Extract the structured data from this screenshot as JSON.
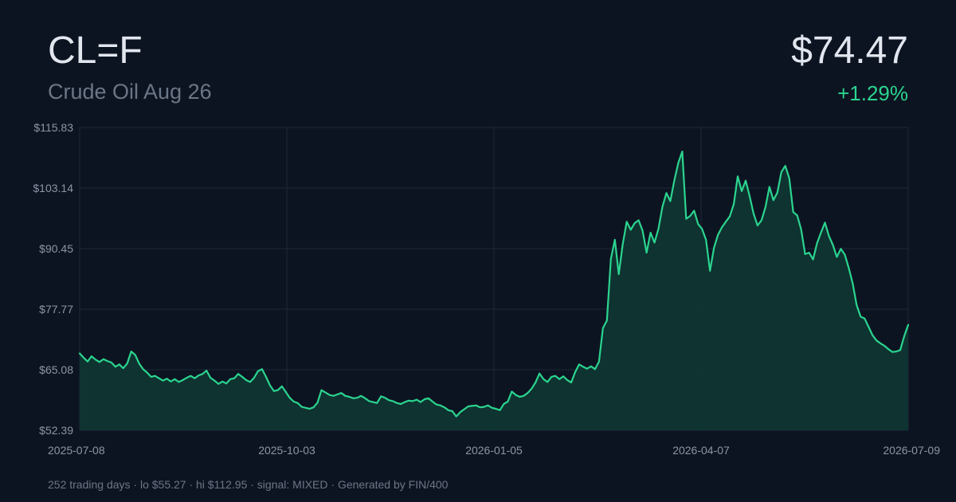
{
  "header": {
    "ticker": "CL=F",
    "name": "Crude Oil Aug 26",
    "price": "$74.47",
    "change": "+1.29%"
  },
  "footer": {
    "text": "252 trading days · lo $55.27 · hi $112.95 · signal: MIXED · Generated by FIN/400"
  },
  "colors": {
    "background": "#0d1421",
    "line": "#2bd48f",
    "fill": "#0f3532",
    "grid": "#1c2737",
    "positive": "#2bd48f"
  },
  "chart_data": {
    "type": "area",
    "ylim": [
      52.39,
      115.83
    ],
    "y_ticks": [
      "$115.83",
      "$103.14",
      "$90.45",
      "$77.77",
      "$65.08",
      "$52.39"
    ],
    "x_ticks": [
      "2025-07-08",
      "2025-10-03",
      "2026-01-05",
      "2026-04-07",
      "2026-07-09"
    ],
    "grid": true,
    "points": [
      [
        0,
        68.5
      ],
      [
        3,
        67.6
      ],
      [
        6,
        66.8
      ],
      [
        9,
        67.9
      ],
      [
        12,
        67.2
      ],
      [
        15,
        66.7
      ],
      [
        18,
        67.3
      ],
      [
        21,
        66.9
      ],
      [
        24,
        66.6
      ],
      [
        27,
        65.7
      ],
      [
        30,
        66.2
      ],
      [
        33,
        65.4
      ],
      [
        36,
        66.4
      ],
      [
        39,
        68.9
      ],
      [
        42,
        68.2
      ],
      [
        45,
        66.4
      ],
      [
        48,
        65.2
      ],
      [
        51,
        64.5
      ],
      [
        54,
        63.6
      ],
      [
        57,
        63.8
      ],
      [
        60,
        63.3
      ],
      [
        63,
        62.8
      ],
      [
        66,
        63.2
      ],
      [
        69,
        62.6
      ],
      [
        72,
        63.1
      ],
      [
        75,
        62.5
      ],
      [
        78,
        62.9
      ],
      [
        81,
        63.4
      ],
      [
        84,
        63.8
      ],
      [
        87,
        63.3
      ],
      [
        90,
        63.9
      ],
      [
        93,
        64.2
      ],
      [
        96,
        64.9
      ],
      [
        99,
        63.4
      ],
      [
        102,
        62.8
      ],
      [
        105,
        62.1
      ],
      [
        108,
        62.6
      ],
      [
        111,
        62.2
      ],
      [
        114,
        63.1
      ],
      [
        117,
        63.3
      ],
      [
        120,
        64.2
      ],
      [
        123,
        63.6
      ],
      [
        126,
        62.9
      ],
      [
        129,
        62.5
      ],
      [
        132,
        63.4
      ],
      [
        135,
        64.8
      ],
      [
        138,
        65.2
      ],
      [
        141,
        63.6
      ],
      [
        144,
        61.8
      ],
      [
        147,
        60.6
      ],
      [
        150,
        60.8
      ],
      [
        153,
        61.6
      ],
      [
        156,
        60.4
      ],
      [
        159,
        59.2
      ],
      [
        162,
        58.4
      ],
      [
        165,
        58.1
      ],
      [
        168,
        57.3
      ],
      [
        171,
        57.1
      ],
      [
        174,
        56.9
      ],
      [
        177,
        57.2
      ],
      [
        180,
        58.2
      ],
      [
        183,
        60.8
      ],
      [
        186,
        60.3
      ],
      [
        189,
        59.8
      ],
      [
        192,
        59.6
      ],
      [
        195,
        59.9
      ],
      [
        198,
        60.2
      ],
      [
        201,
        59.6
      ],
      [
        204,
        59.4
      ],
      [
        207,
        59.1
      ],
      [
        210,
        59.2
      ],
      [
        213,
        59.6
      ],
      [
        216,
        59.1
      ],
      [
        219,
        58.5
      ],
      [
        222,
        58.3
      ],
      [
        225,
        58.1
      ],
      [
        228,
        59.5
      ],
      [
        231,
        59.2
      ],
      [
        234,
        58.7
      ],
      [
        237,
        58.5
      ],
      [
        240,
        58.1
      ],
      [
        243,
        57.9
      ],
      [
        246,
        58.3
      ],
      [
        249,
        58.6
      ],
      [
        252,
        58.5
      ],
      [
        255,
        58.8
      ],
      [
        258,
        58.3
      ],
      [
        261,
        58.9
      ],
      [
        264,
        59.1
      ],
      [
        267,
        58.4
      ],
      [
        270,
        57.8
      ],
      [
        273,
        57.6
      ],
      [
        276,
        57.2
      ],
      [
        279,
        56.6
      ],
      [
        282,
        56.4
      ],
      [
        285,
        55.3
      ],
      [
        288,
        56.2
      ],
      [
        291,
        56.8
      ],
      [
        294,
        57.4
      ],
      [
        297,
        57.5
      ],
      [
        300,
        57.6
      ],
      [
        303,
        57.2
      ],
      [
        306,
        57.3
      ],
      [
        309,
        57.6
      ],
      [
        312,
        57.1
      ],
      [
        315,
        56.9
      ],
      [
        318,
        56.6
      ],
      [
        321,
        57.9
      ],
      [
        324,
        58.4
      ],
      [
        327,
        60.5
      ],
      [
        330,
        59.8
      ],
      [
        333,
        59.4
      ],
      [
        336,
        59.6
      ],
      [
        339,
        60.2
      ],
      [
        342,
        61.1
      ],
      [
        345,
        62.4
      ],
      [
        348,
        64.3
      ],
      [
        351,
        63.1
      ],
      [
        354,
        62.5
      ],
      [
        357,
        63.6
      ],
      [
        360,
        63.8
      ],
      [
        363,
        63.1
      ],
      [
        366,
        63.7
      ],
      [
        369,
        62.9
      ],
      [
        372,
        62.4
      ],
      [
        375,
        64.6
      ],
      [
        378,
        66.2
      ],
      [
        381,
        65.7
      ],
      [
        384,
        65.3
      ],
      [
        387,
        65.8
      ],
      [
        390,
        65.2
      ],
      [
        393,
        66.8
      ],
      [
        396,
        73.8
      ],
      [
        399,
        75.4
      ],
      [
        402,
        88.3
      ],
      [
        405,
        92.3
      ],
      [
        408,
        85.1
      ],
      [
        411,
        91.4
      ],
      [
        414,
        96.1
      ],
      [
        417,
        94.4
      ],
      [
        420,
        95.8
      ],
      [
        423,
        96.4
      ],
      [
        426,
        94.2
      ],
      [
        429,
        89.6
      ],
      [
        432,
        93.8
      ],
      [
        435,
        91.7
      ],
      [
        438,
        94.6
      ],
      [
        441,
        99.2
      ],
      [
        444,
        102.1
      ],
      [
        447,
        100.4
      ],
      [
        450,
        104.7
      ],
      [
        453,
        108.4
      ],
      [
        456,
        110.8
      ],
      [
        459,
        96.7
      ],
      [
        462,
        97.3
      ],
      [
        465,
        98.4
      ],
      [
        468,
        95.6
      ],
      [
        471,
        94.6
      ],
      [
        474,
        92.3
      ],
      [
        477,
        85.8
      ],
      [
        480,
        90.6
      ],
      [
        483,
        93.3
      ],
      [
        486,
        94.9
      ],
      [
        489,
        96.1
      ],
      [
        492,
        97.2
      ],
      [
        495,
        99.8
      ],
      [
        498,
        105.6
      ],
      [
        501,
        102.5
      ],
      [
        504,
        104.7
      ],
      [
        507,
        101.4
      ],
      [
        510,
        97.8
      ],
      [
        513,
        95.3
      ],
      [
        516,
        96.4
      ],
      [
        519,
        99.2
      ],
      [
        522,
        103.4
      ],
      [
        525,
        100.6
      ],
      [
        528,
        102.2
      ],
      [
        531,
        106.5
      ],
      [
        534,
        107.8
      ],
      [
        537,
        105.2
      ],
      [
        540,
        98.1
      ],
      [
        543,
        97.4
      ],
      [
        546,
        94.5
      ],
      [
        549,
        89.3
      ],
      [
        552,
        89.6
      ],
      [
        555,
        88.2
      ],
      [
        558,
        91.6
      ],
      [
        561,
        93.8
      ],
      [
        564,
        95.9
      ],
      [
        567,
        93.1
      ],
      [
        570,
        91.2
      ],
      [
        573,
        88.7
      ],
      [
        576,
        90.4
      ],
      [
        579,
        89.2
      ],
      [
        582,
        86.4
      ],
      [
        585,
        83.2
      ],
      [
        588,
        78.6
      ],
      [
        591,
        76.2
      ],
      [
        594,
        75.8
      ],
      [
        597,
        74.1
      ],
      [
        600,
        72.3
      ],
      [
        603,
        71.2
      ],
      [
        606,
        70.6
      ],
      [
        609,
        70.1
      ],
      [
        612,
        69.4
      ],
      [
        615,
        68.8
      ],
      [
        618,
        68.9
      ],
      [
        621,
        69.2
      ],
      [
        624,
        72.1
      ],
      [
        627,
        74.47
      ]
    ]
  }
}
